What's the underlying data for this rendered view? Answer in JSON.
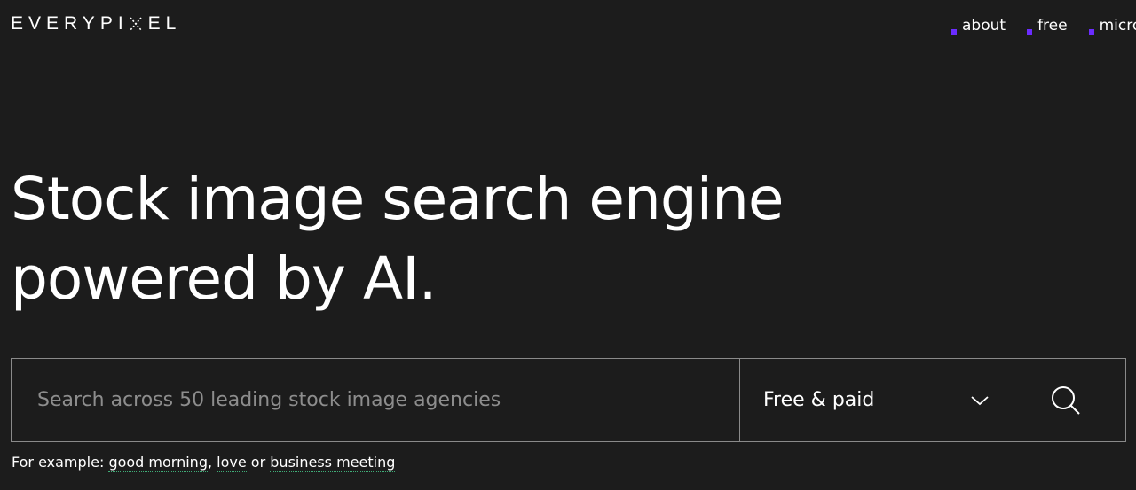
{
  "logo": {
    "text_before": "EVERYPI",
    "text_after": "EL",
    "mark_icon": "x-cross-mark-icon"
  },
  "nav": {
    "items": [
      {
        "label": "about"
      },
      {
        "label": "free"
      },
      {
        "label": "micro"
      }
    ]
  },
  "hero": {
    "line1": "Stock image search engine",
    "line2": "powered by AI."
  },
  "search": {
    "placeholder": "Search across 50 leading stock image agencies",
    "value": "",
    "filter_selected": "Free & paid",
    "filter_icon": "chevron-down-icon",
    "submit_icon": "search-icon"
  },
  "examples": {
    "prefix": "For example:",
    "items": [
      "good morning",
      "love",
      "business meeting"
    ],
    "separator_comma": ",",
    "separator_or": "or"
  },
  "colors": {
    "background": "#1c1c1c",
    "accent": "#6b2cff",
    "border": "#8a8a8a",
    "link_underline": "#3fae78"
  }
}
